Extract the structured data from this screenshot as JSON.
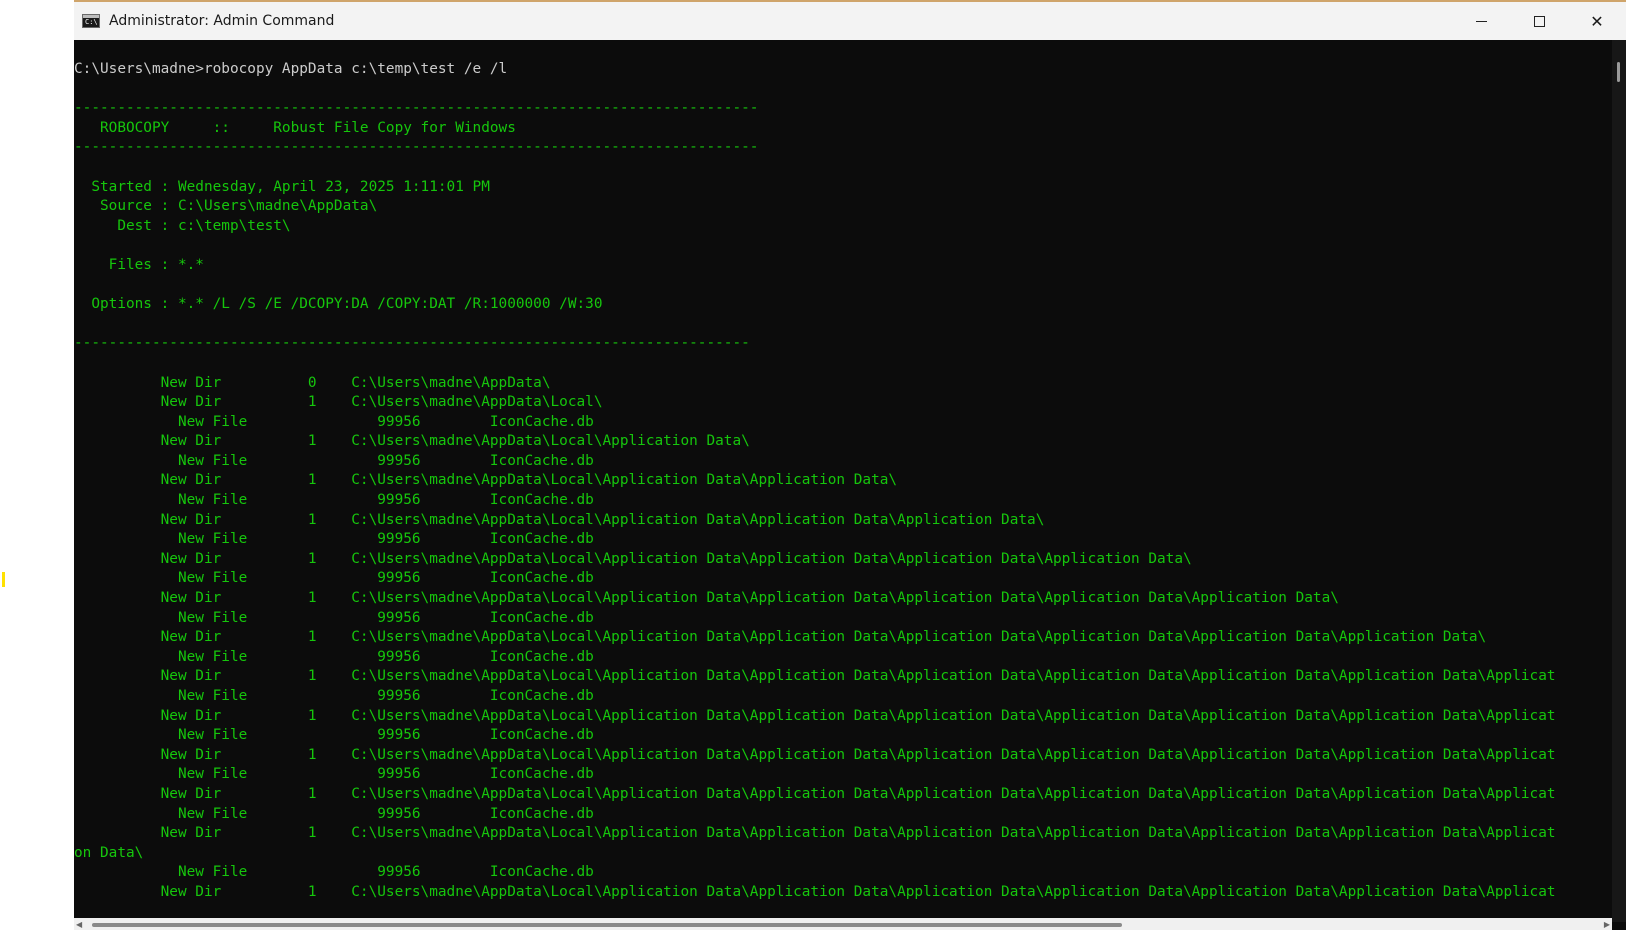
{
  "window": {
    "title": "Administrator: Admin Command",
    "icon_text": "C:\\",
    "controls": {
      "minimize": "minimize-icon",
      "maximize": "maximize-icon",
      "close_glyph": "✕"
    }
  },
  "console": {
    "lines": [
      {
        "text": "C:\\Users\\madne>robocopy AppData c:\\temp\\test /e /l",
        "color": "default"
      },
      {
        "text": "",
        "color": "default"
      },
      {
        "text": "-------------------------------------------------------------------------------",
        "color": "green"
      },
      {
        "text": "   ROBOCOPY     ::     Robust File Copy for Windows",
        "color": "green"
      },
      {
        "text": "-------------------------------------------------------------------------------",
        "color": "green"
      },
      {
        "text": "",
        "color": "default"
      },
      {
        "text": "  Started : Wednesday, April 23, 2025 1:11:01 PM",
        "color": "green"
      },
      {
        "text": "   Source : C:\\Users\\madne\\AppData\\",
        "color": "green"
      },
      {
        "text": "     Dest : c:\\temp\\test\\",
        "color": "green"
      },
      {
        "text": "",
        "color": "default"
      },
      {
        "text": "    Files : *.*",
        "color": "green"
      },
      {
        "text": "",
        "color": "default"
      },
      {
        "text": "  Options : *.* /L /S /E /DCOPY:DA /COPY:DAT /R:1000000 /W:30",
        "color": "green"
      },
      {
        "text": "",
        "color": "default"
      },
      {
        "text": "------------------------------------------------------------------------------",
        "color": "green"
      },
      {
        "text": "",
        "color": "default"
      },
      {
        "text": "          New Dir          0    C:\\Users\\madne\\AppData\\",
        "color": "green"
      },
      {
        "text": "          New Dir          1    C:\\Users\\madne\\AppData\\Local\\",
        "color": "green"
      },
      {
        "text": "            New File               99956        IconCache.db",
        "color": "green"
      },
      {
        "text": "          New Dir          1    C:\\Users\\madne\\AppData\\Local\\Application Data\\",
        "color": "green"
      },
      {
        "text": "            New File               99956        IconCache.db",
        "color": "green"
      },
      {
        "text": "          New Dir          1    C:\\Users\\madne\\AppData\\Local\\Application Data\\Application Data\\",
        "color": "green"
      },
      {
        "text": "            New File               99956        IconCache.db",
        "color": "green"
      },
      {
        "text": "          New Dir          1    C:\\Users\\madne\\AppData\\Local\\Application Data\\Application Data\\Application Data\\",
        "color": "green"
      },
      {
        "text": "            New File               99956        IconCache.db",
        "color": "green"
      },
      {
        "text": "          New Dir          1    C:\\Users\\madne\\AppData\\Local\\Application Data\\Application Data\\Application Data\\Application Data\\",
        "color": "green"
      },
      {
        "text": "            New File               99956        IconCache.db",
        "color": "green"
      },
      {
        "text": "          New Dir          1    C:\\Users\\madne\\AppData\\Local\\Application Data\\Application Data\\Application Data\\Application Data\\Application Data\\",
        "color": "green"
      },
      {
        "text": "            New File               99956        IconCache.db",
        "color": "green"
      },
      {
        "text": "          New Dir          1    C:\\Users\\madne\\AppData\\Local\\Application Data\\Application Data\\Application Data\\Application Data\\Application Data\\Application Data\\",
        "color": "green"
      },
      {
        "text": "            New File               99956        IconCache.db",
        "color": "green"
      },
      {
        "text": "          New Dir          1    C:\\Users\\madne\\AppData\\Local\\Application Data\\Application Data\\Application Data\\Application Data\\Application Data\\Application Data\\Applicat",
        "color": "green"
      },
      {
        "text": "            New File               99956        IconCache.db",
        "color": "green"
      },
      {
        "text": "          New Dir          1    C:\\Users\\madne\\AppData\\Local\\Application Data\\Application Data\\Application Data\\Application Data\\Application Data\\Application Data\\Applicat",
        "color": "green"
      },
      {
        "text": "            New File               99956        IconCache.db",
        "color": "green"
      },
      {
        "text": "          New Dir          1    C:\\Users\\madne\\AppData\\Local\\Application Data\\Application Data\\Application Data\\Application Data\\Application Data\\Application Data\\Applicat",
        "color": "green"
      },
      {
        "text": "            New File               99956        IconCache.db",
        "color": "green"
      },
      {
        "text": "          New Dir          1    C:\\Users\\madne\\AppData\\Local\\Application Data\\Application Data\\Application Data\\Application Data\\Application Data\\Application Data\\Applicat",
        "color": "green"
      },
      {
        "text": "            New File               99956        IconCache.db",
        "color": "green"
      },
      {
        "text": "          New Dir          1    C:\\Users\\madne\\AppData\\Local\\Application Data\\Application Data\\Application Data\\Application Data\\Application Data\\Application Data\\Applicat",
        "color": "green"
      },
      {
        "text": "on Data\\",
        "color": "green"
      },
      {
        "text": "            New File               99956        IconCache.db",
        "color": "green"
      },
      {
        "text": "          New Dir          1    C:\\Users\\madne\\AppData\\Local\\Application Data\\Application Data\\Application Data\\Application Data\\Application Data\\Application Data\\Applicat",
        "color": "green"
      }
    ]
  },
  "colors": {
    "console_bg": "#0c0c0c",
    "console_fg": "#cccccc",
    "green": "#16c60c",
    "titlebar_bg": "#f3f3f3"
  }
}
